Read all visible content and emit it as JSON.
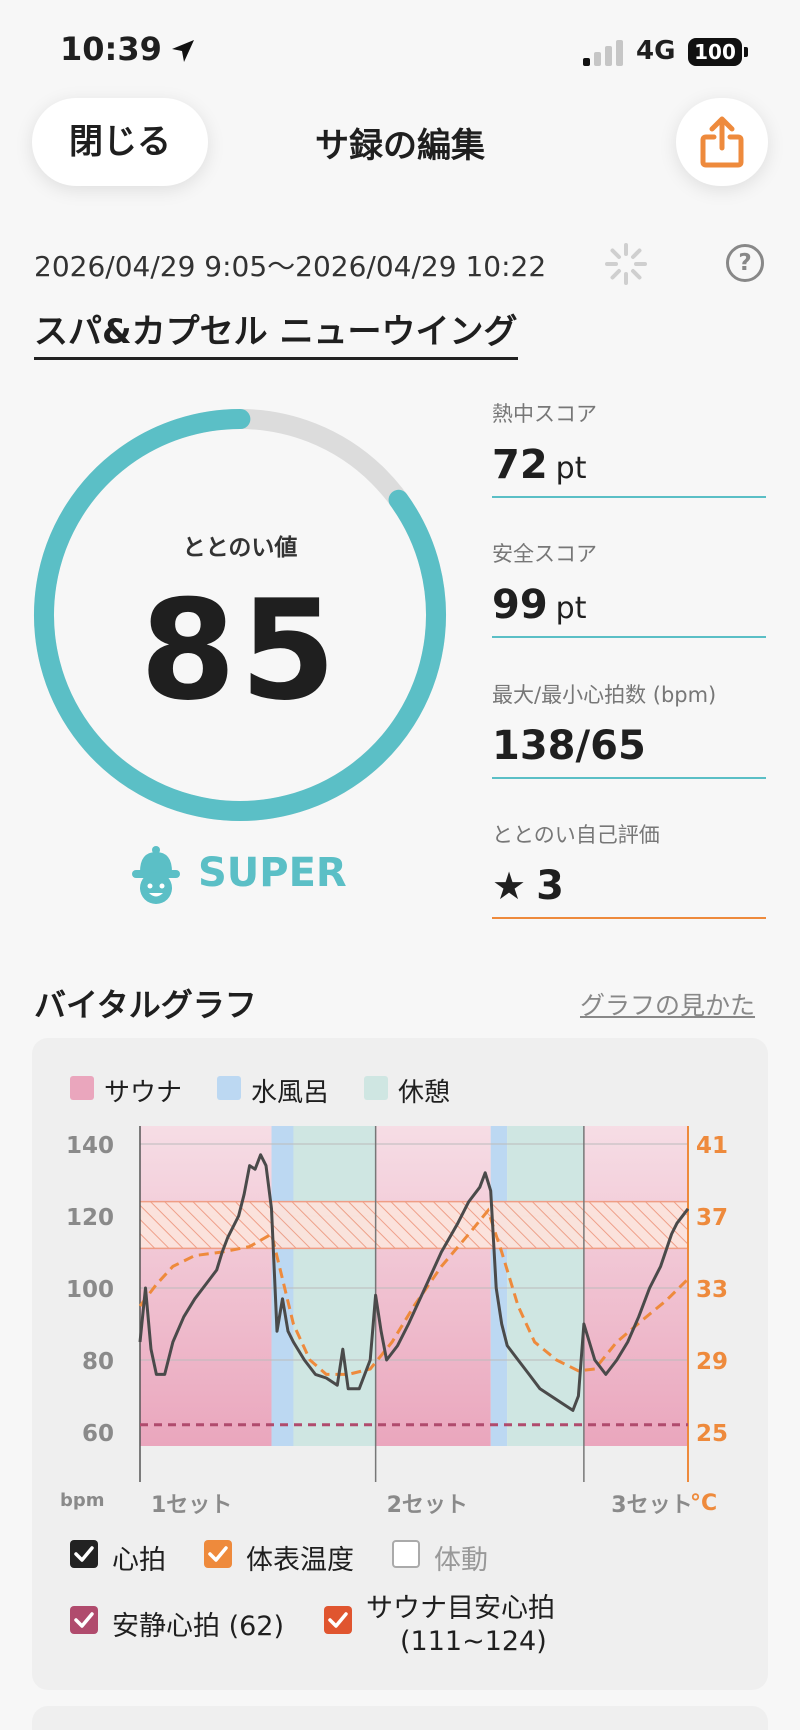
{
  "status_bar": {
    "time": "10:39",
    "network": "4G",
    "battery": "100"
  },
  "header": {
    "close_label": "閉じる",
    "title": "サ録の編集"
  },
  "session": {
    "date_range": "2026/04/29 9:05〜2026/04/29 10:22",
    "facility": "スパ&カプセル ニューウイング"
  },
  "totonoi": {
    "label": "ととのい値",
    "value": "85",
    "progress": 0.85,
    "rank": "SUPER"
  },
  "stats": [
    {
      "label": "熱中スコア",
      "value": "72",
      "unit": "pt"
    },
    {
      "label": "安全スコア",
      "value": "99",
      "unit": "pt"
    },
    {
      "label": "最大/最小心拍数 (bpm)",
      "value": "138/65",
      "unit": ""
    },
    {
      "label": "ととのい自己評価",
      "value": "3",
      "unit": "",
      "icon": "star-icon"
    }
  ],
  "vital": {
    "title": "バイタルグラフ",
    "how_link": "グラフの見かた"
  },
  "colors": {
    "accent_teal": "#5bbfc6",
    "accent_orange": "#ee8a3c",
    "sauna": "#eaa6bd",
    "cold_bath": "#bcd8f2",
    "rest": "#cfe6e2"
  },
  "chart_data": {
    "type": "line",
    "phase_legend": [
      "サウナ",
      "水風呂",
      "休憩"
    ],
    "phases": [
      {
        "type": "サウナ",
        "start": 0.0,
        "end": 0.24
      },
      {
        "type": "水風呂",
        "start": 0.24,
        "end": 0.28
      },
      {
        "type": "休憩",
        "start": 0.28,
        "end": 0.43
      },
      {
        "type": "サウナ",
        "start": 0.43,
        "end": 0.64
      },
      {
        "type": "水風呂",
        "start": 0.64,
        "end": 0.67
      },
      {
        "type": "休憩",
        "start": 0.67,
        "end": 0.81
      },
      {
        "type": "サウナ",
        "start": 0.81,
        "end": 1.0
      }
    ],
    "set_dividers": [
      0.43,
      0.81
    ],
    "x_labels": [
      {
        "label": "1セット",
        "x": 0.02
      },
      {
        "label": "2セット",
        "x": 0.45
      },
      {
        "label": "3セット",
        "x": 0.86
      }
    ],
    "y_left": {
      "unit": "bpm",
      "ticks": [
        140,
        120,
        100,
        80,
        60
      ],
      "range": [
        60,
        140
      ]
    },
    "y_right": {
      "unit": "°C",
      "ticks": [
        41,
        37,
        33,
        29,
        25
      ],
      "range": [
        25,
        41
      ]
    },
    "heart_rate": [
      [
        0.0,
        85
      ],
      [
        0.01,
        100
      ],
      [
        0.02,
        83
      ],
      [
        0.03,
        76
      ],
      [
        0.045,
        76
      ],
      [
        0.06,
        85
      ],
      [
        0.08,
        92
      ],
      [
        0.1,
        97
      ],
      [
        0.12,
        101
      ],
      [
        0.14,
        105
      ],
      [
        0.15,
        110
      ],
      [
        0.16,
        114
      ],
      [
        0.18,
        120
      ],
      [
        0.19,
        126
      ],
      [
        0.2,
        134
      ],
      [
        0.21,
        133
      ],
      [
        0.22,
        137
      ],
      [
        0.23,
        134
      ],
      [
        0.24,
        122
      ],
      [
        0.25,
        88
      ],
      [
        0.26,
        97
      ],
      [
        0.27,
        88
      ],
      [
        0.28,
        85
      ],
      [
        0.3,
        80
      ],
      [
        0.32,
        76
      ],
      [
        0.34,
        75
      ],
      [
        0.36,
        73
      ],
      [
        0.37,
        83
      ],
      [
        0.38,
        72
      ],
      [
        0.4,
        72
      ],
      [
        0.42,
        80
      ],
      [
        0.43,
        98
      ],
      [
        0.44,
        88
      ],
      [
        0.45,
        80
      ],
      [
        0.47,
        84
      ],
      [
        0.49,
        90
      ],
      [
        0.52,
        100
      ],
      [
        0.55,
        110
      ],
      [
        0.58,
        118
      ],
      [
        0.6,
        124
      ],
      [
        0.62,
        128
      ],
      [
        0.63,
        132
      ],
      [
        0.64,
        127
      ],
      [
        0.65,
        100
      ],
      [
        0.66,
        90
      ],
      [
        0.67,
        84
      ],
      [
        0.69,
        80
      ],
      [
        0.71,
        76
      ],
      [
        0.73,
        72
      ],
      [
        0.75,
        70
      ],
      [
        0.77,
        68
      ],
      [
        0.79,
        66
      ],
      [
        0.8,
        70
      ],
      [
        0.81,
        90
      ],
      [
        0.83,
        80
      ],
      [
        0.85,
        76
      ],
      [
        0.87,
        80
      ],
      [
        0.89,
        85
      ],
      [
        0.91,
        92
      ],
      [
        0.93,
        100
      ],
      [
        0.95,
        106
      ],
      [
        0.97,
        115
      ],
      [
        0.98,
        118
      ],
      [
        1.0,
        122
      ]
    ],
    "body_temp": [
      [
        0.0,
        32
      ],
      [
        0.03,
        33.2
      ],
      [
        0.06,
        34.2
      ],
      [
        0.1,
        34.8
      ],
      [
        0.15,
        35.0
      ],
      [
        0.2,
        35.3
      ],
      [
        0.24,
        36.0
      ],
      [
        0.26,
        33.5
      ],
      [
        0.28,
        31.0
      ],
      [
        0.31,
        29.0
      ],
      [
        0.34,
        28.2
      ],
      [
        0.38,
        28.2
      ],
      [
        0.42,
        28.5
      ],
      [
        0.46,
        30.0
      ],
      [
        0.5,
        32.0
      ],
      [
        0.55,
        34.2
      ],
      [
        0.6,
        36.0
      ],
      [
        0.635,
        37.3
      ],
      [
        0.66,
        35.0
      ],
      [
        0.69,
        32.0
      ],
      [
        0.72,
        30.0
      ],
      [
        0.76,
        29.0
      ],
      [
        0.8,
        28.4
      ],
      [
        0.83,
        28.5
      ],
      [
        0.87,
        30.0
      ],
      [
        0.92,
        31.3
      ],
      [
        0.96,
        32.3
      ],
      [
        1.0,
        33.5
      ]
    ],
    "resting_hr": 62,
    "target_band": [
      111,
      124
    ],
    "legend": [
      {
        "label": "心拍",
        "checked": true,
        "color": "#222222"
      },
      {
        "label": "体表温度",
        "checked": true,
        "color": "#ee8a3c"
      },
      {
        "label": "体動",
        "checked": false,
        "color": "#aaaaaa"
      },
      {
        "label": "安静心拍 (62)",
        "checked": true,
        "color": "#b04b6d"
      },
      {
        "label": "サウナ目安心拍",
        "label2": "(111~124)",
        "checked": true,
        "color": "#e0552f"
      }
    ]
  }
}
